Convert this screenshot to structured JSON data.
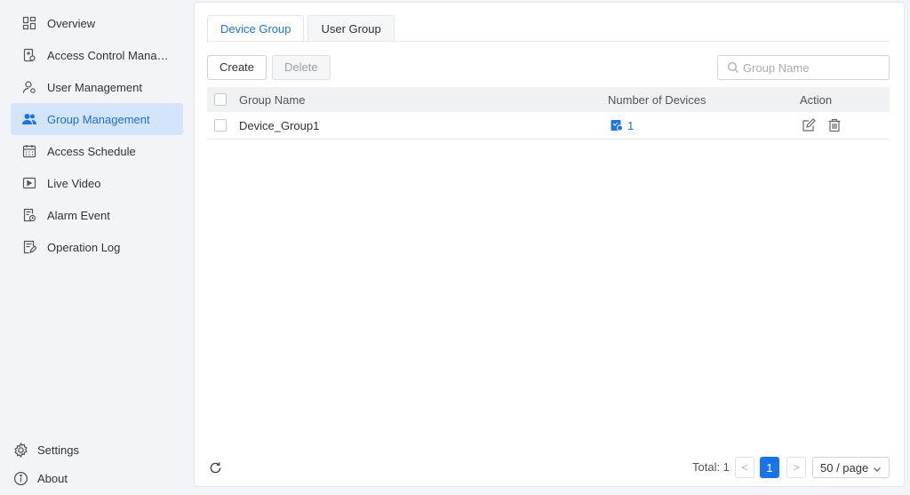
{
  "sidebar": {
    "items": [
      {
        "label": "Overview",
        "icon": "overview-icon"
      },
      {
        "label": "Access Control Manag...",
        "icon": "access-control-icon"
      },
      {
        "label": "User Management",
        "icon": "user-icon"
      },
      {
        "label": "Group Management",
        "icon": "group-icon",
        "active": true
      },
      {
        "label": "Access Schedule",
        "icon": "calendar-icon"
      },
      {
        "label": "Live Video",
        "icon": "video-icon"
      },
      {
        "label": "Alarm Event",
        "icon": "alarm-icon"
      },
      {
        "label": "Operation Log",
        "icon": "log-icon"
      }
    ],
    "bottom": [
      {
        "label": "Settings",
        "icon": "gear-icon"
      },
      {
        "label": "About",
        "icon": "info-icon"
      }
    ]
  },
  "tabs": [
    {
      "label": "Device Group",
      "active": true
    },
    {
      "label": "User Group",
      "active": false
    }
  ],
  "toolbar": {
    "create_label": "Create",
    "delete_label": "Delete",
    "search_placeholder": "Group Name"
  },
  "table": {
    "headers": {
      "group_name": "Group Name",
      "devices": "Number of Devices",
      "action": "Action"
    },
    "rows": [
      {
        "group_name": "Device_Group1",
        "devices": "1"
      }
    ]
  },
  "pagination": {
    "total_label": "Total: 1",
    "current_page": "1",
    "page_size": "50 / page",
    "prev": "<",
    "next": ">"
  },
  "colors": {
    "accent": "#1a73e8",
    "active_bg": "#d4e4fa"
  }
}
